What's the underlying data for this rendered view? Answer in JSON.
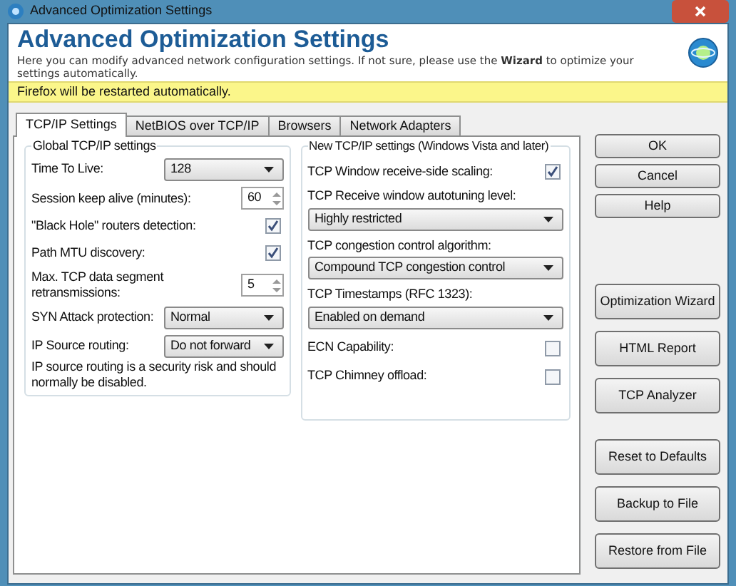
{
  "window": {
    "title": "Advanced Optimization Settings"
  },
  "header": {
    "title": "Advanced Optimization Settings",
    "description": "Here you can modify advanced network configuration settings. If not sure, please use the **Wizard** to optimize your settings automatically."
  },
  "notice": "Firefox will be restarted automatically.",
  "tabs": [
    {
      "label": "TCP/IP Settings",
      "selected": true
    },
    {
      "label": "NetBIOS over TCP/IP",
      "selected": false
    },
    {
      "label": "Browsers",
      "selected": false
    },
    {
      "label": "Network Adapters",
      "selected": false
    }
  ],
  "global_group": {
    "title": "Global TCP/IP settings",
    "items": [
      {
        "kind": "dropdown",
        "label": "Time To Live:",
        "value": "128"
      },
      {
        "kind": "spin",
        "label": "Session keep alive (minutes):",
        "value": "60"
      },
      {
        "kind": "checkbox",
        "label": "\"Black Hole\" routers detection:",
        "checked": true
      },
      {
        "kind": "checkbox",
        "label": "Path MTU discovery:",
        "checked": true
      },
      {
        "kind": "spin",
        "label": "Max. TCP data segment retransmissions:",
        "value": "5"
      },
      {
        "kind": "dropdown",
        "label": "SYN Attack protection:",
        "value": "Normal"
      },
      {
        "kind": "dropdown",
        "label": "IP Source routing:",
        "value": "Do not forward"
      },
      {
        "kind": "note",
        "text": "IP source routing is a security risk and should normally be disabled."
      }
    ]
  },
  "new_group": {
    "title": "New TCP/IP settings (Windows Vista and later)",
    "items": [
      {
        "kind": "checkbox",
        "label": "TCP Window receive-side scaling:",
        "checked": true
      },
      {
        "kind": "dropdown",
        "label": "TCP Receive window autotuning level:",
        "value": "Highly restricted"
      },
      {
        "kind": "dropdown",
        "label": "TCP congestion control algorithm:",
        "value": "Compound TCP congestion control"
      },
      {
        "kind": "dropdown",
        "label": "TCP Timestamps (RFC 1323):",
        "value": "Enabled on demand"
      },
      {
        "kind": "checkbox",
        "label": "ECN Capability:",
        "checked": false
      },
      {
        "kind": "checkbox",
        "label": "TCP Chimney offload:",
        "checked": false
      }
    ]
  },
  "dialog_buttons": [
    "OK",
    "Cancel",
    "Help"
  ],
  "tool_buttons": [
    "Optimization Wizard",
    "HTML Report",
    "TCP Analyzer"
  ],
  "file_buttons": [
    "Reset to Defaults",
    "Backup to File",
    "Restore from File"
  ]
}
